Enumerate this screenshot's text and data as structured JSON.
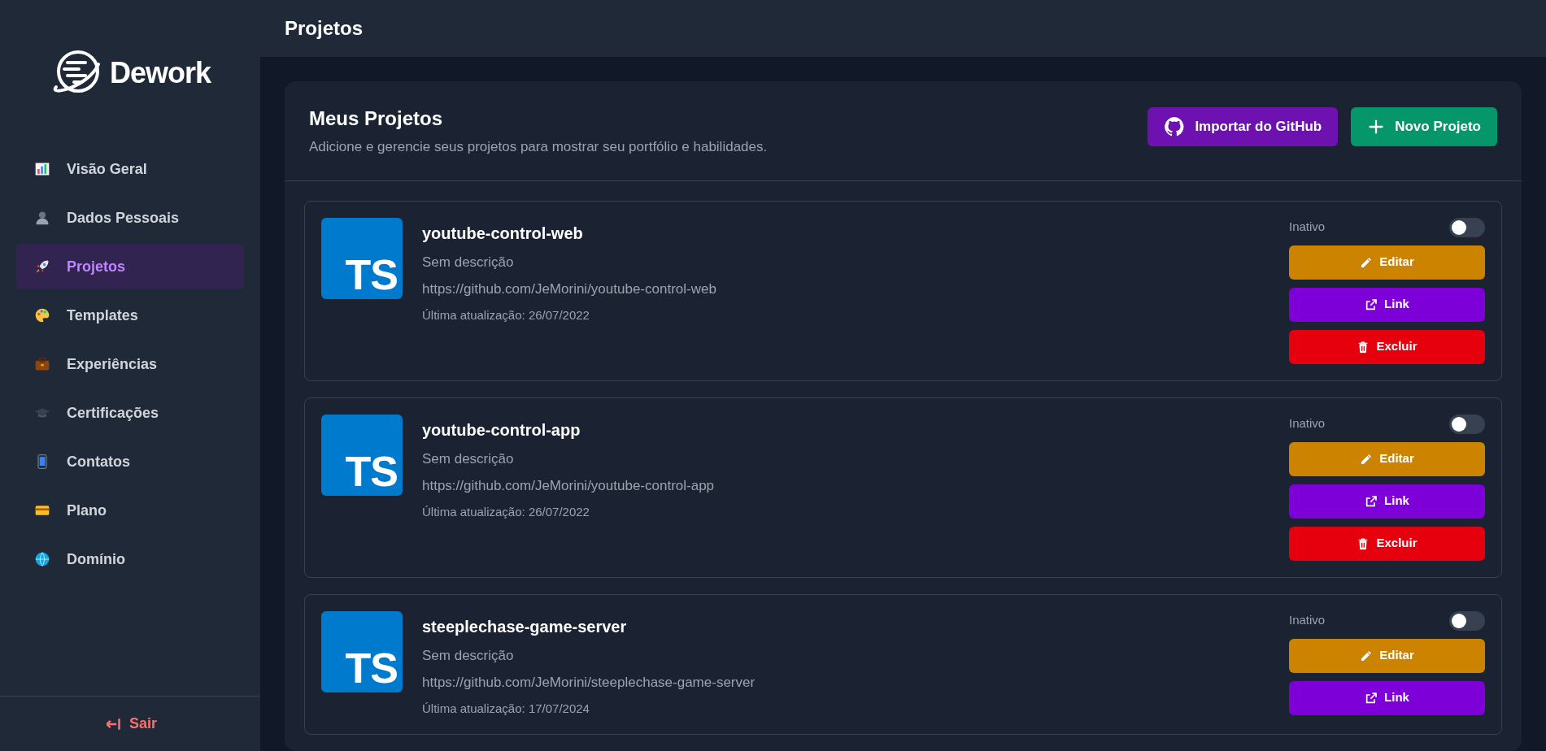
{
  "brand": "Dework",
  "sidebar": {
    "items": [
      {
        "label": "Visão Geral",
        "selected": false
      },
      {
        "label": "Dados Pessoais",
        "selected": false
      },
      {
        "label": "Projetos",
        "selected": true
      },
      {
        "label": "Templates",
        "selected": false
      },
      {
        "label": "Experiências",
        "selected": false
      },
      {
        "label": "Certificações",
        "selected": false
      },
      {
        "label": "Contatos",
        "selected": false
      },
      {
        "label": "Plano",
        "selected": false
      },
      {
        "label": "Domínio",
        "selected": false
      }
    ],
    "logout": "Sair"
  },
  "header": {
    "title": "Projetos"
  },
  "panel": {
    "title": "Meus Projetos",
    "subtitle": "Adicione e gerencie seus projetos para mostrar seu portfólio e habilidades.",
    "buttons": [
      "Importar do GitHub",
      "Novo Projeto"
    ]
  },
  "projects": [
    {
      "name": "youtube-control-web",
      "language": "TS",
      "description": "Sem descrição",
      "url": "https://github.com/JeMorini/youtube-control-web",
      "updated": "Última atualização: 26/07/2022",
      "status": "Inativo",
      "active": false,
      "actions": [
        "Editar",
        "Link",
        "Excluir"
      ]
    },
    {
      "name": "youtube-control-app",
      "language": "TS",
      "description": "Sem descrição",
      "url": "https://github.com/JeMorini/youtube-control-app",
      "updated": "Última atualização: 26/07/2022",
      "status": "Inativo",
      "active": false,
      "actions": [
        "Editar",
        "Link",
        "Excluir"
      ]
    },
    {
      "name": "steeplechase-game-server",
      "language": "TS",
      "description": "Sem descrição",
      "url": "https://github.com/JeMorini/steeplechase-game-server",
      "updated": "Última atualização: 17/07/2024",
      "status": "Inativo",
      "active": false,
      "actions": [
        "Editar",
        "Link"
      ]
    }
  ]
}
